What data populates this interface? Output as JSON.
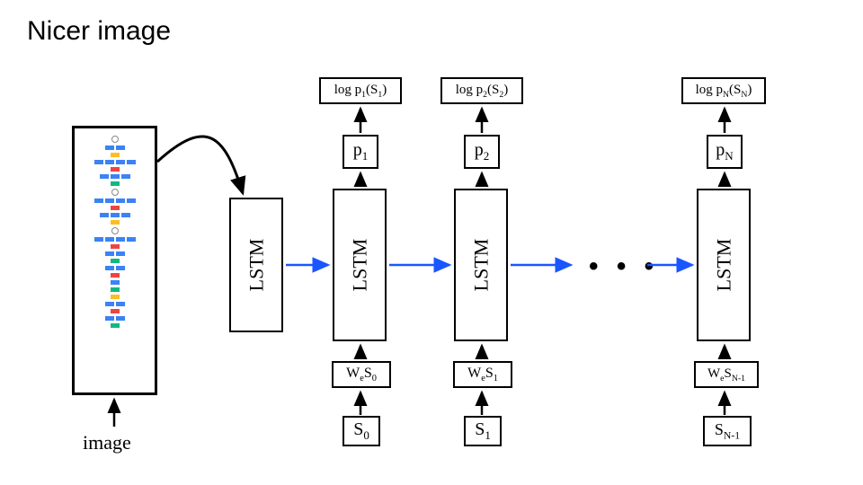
{
  "title": "Nicer image",
  "input_label": "image",
  "lstm_label": "LSTM",
  "ellipsis": "• • •",
  "columns": {
    "c1": {
      "p": "p",
      "p_sub": "1",
      "logp": "log p",
      "logp_sub1": "1",
      "logp_arg": "(S",
      "logp_sub2": "1",
      "logp_close": ")",
      "we_pre": "W",
      "we_e": "e",
      "we_s": "S",
      "we_sub": "0",
      "s": "S",
      "s_sub": "0"
    },
    "c2": {
      "p": "p",
      "p_sub": "2",
      "logp": "log p",
      "logp_sub1": "2",
      "logp_arg": "(S",
      "logp_sub2": "2",
      "logp_close": ")",
      "we_pre": "W",
      "we_e": "e",
      "we_s": "S",
      "we_sub": "1",
      "s": "S",
      "s_sub": "1"
    },
    "cN": {
      "p": "p",
      "p_sub": "N",
      "logp": "log p",
      "logp_sub1": "N",
      "logp_arg": "(S",
      "logp_sub2": "N",
      "logp_close": ")",
      "we_pre": "W",
      "we_e": "e",
      "we_s": "S",
      "we_sub": "N-1",
      "s": "S",
      "s_sub": "N-1"
    }
  }
}
